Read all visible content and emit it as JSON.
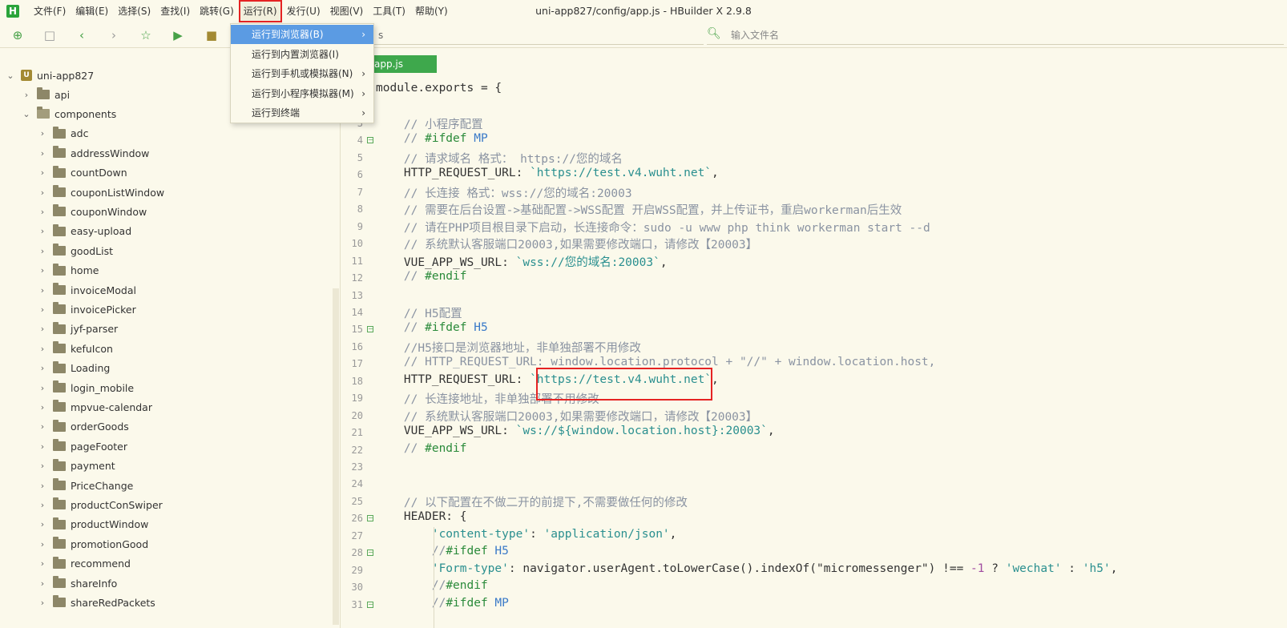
{
  "window": {
    "title": "uni-app827/config/app.js - HBuilder X 2.9.8",
    "logo": "H"
  },
  "menubar": [
    {
      "id": "file",
      "label": "文件(F)"
    },
    {
      "id": "edit",
      "label": "编辑(E)"
    },
    {
      "id": "select",
      "label": "选择(S)"
    },
    {
      "id": "find",
      "label": "查找(I)"
    },
    {
      "id": "goto",
      "label": "跳转(G)"
    },
    {
      "id": "run",
      "label": "运行(R)"
    },
    {
      "id": "publish",
      "label": "发行(U)"
    },
    {
      "id": "view",
      "label": "视图(V)"
    },
    {
      "id": "tools",
      "label": "工具(T)"
    },
    {
      "id": "help",
      "label": "帮助(Y)"
    }
  ],
  "run_menu": [
    {
      "label": "运行到浏览器(B)",
      "submenu": true,
      "highlighted": true
    },
    {
      "label": "运行到内置浏览器(I)",
      "submenu": false
    },
    {
      "label": "运行到手机或模拟器(N)",
      "submenu": true
    },
    {
      "label": "运行到小程序模拟器(M)",
      "submenu": true
    },
    {
      "label": "运行到终端",
      "submenu": true
    }
  ],
  "toolbar": {
    "path_fragment": "s",
    "file_search_placeholder": "输入文件名"
  },
  "sidebar": {
    "project": "uni-app827",
    "items": [
      {
        "label": "api",
        "level": 1,
        "expanded": false
      },
      {
        "label": "components",
        "level": 1,
        "expanded": true
      },
      {
        "label": "adc",
        "level": 2
      },
      {
        "label": "addressWindow",
        "level": 2
      },
      {
        "label": "countDown",
        "level": 2
      },
      {
        "label": "couponListWindow",
        "level": 2
      },
      {
        "label": "couponWindow",
        "level": 2
      },
      {
        "label": "easy-upload",
        "level": 2
      },
      {
        "label": "goodList",
        "level": 2
      },
      {
        "label": "home",
        "level": 2
      },
      {
        "label": "invoiceModal",
        "level": 2
      },
      {
        "label": "invoicePicker",
        "level": 2
      },
      {
        "label": "jyf-parser",
        "level": 2
      },
      {
        "label": "kefuIcon",
        "level": 2
      },
      {
        "label": "Loading",
        "level": 2
      },
      {
        "label": "login_mobile",
        "level": 2
      },
      {
        "label": "mpvue-calendar",
        "level": 2
      },
      {
        "label": "orderGoods",
        "level": 2
      },
      {
        "label": "pageFooter",
        "level": 2
      },
      {
        "label": "payment",
        "level": 2
      },
      {
        "label": "PriceChange",
        "level": 2
      },
      {
        "label": "productConSwiper",
        "level": 2
      },
      {
        "label": "productWindow",
        "level": 2
      },
      {
        "label": "promotionGood",
        "level": 2
      },
      {
        "label": "recommend",
        "level": 2
      },
      {
        "label": "shareInfo",
        "level": 2
      },
      {
        "label": "shareRedPackets",
        "level": 2
      }
    ]
  },
  "editor": {
    "tab_label": "app.js",
    "lines": [
      {
        "n": "",
        "segs": [
          [
            "module.exports = {",
            ""
          ]
        ],
        "fold": ""
      },
      {
        "n": "3",
        "segs": [
          [
            "    // 小程序配置",
            "cm"
          ]
        ],
        "fold": ""
      },
      {
        "n": "4",
        "segs": [
          [
            "    // ",
            "cm"
          ],
          [
            "#ifdef",
            "kw"
          ],
          [
            " MP",
            "mac"
          ]
        ],
        "fold": "minus"
      },
      {
        "n": "5",
        "segs": [
          [
            "    // 请求域名 格式： https://您的域名",
            "cm"
          ]
        ],
        "fold": ""
      },
      {
        "n": "6",
        "segs": [
          [
            "    HTTP_REQUEST_URL: ",
            ""
          ],
          [
            "`https://test.v4.wuht.net`",
            "str"
          ],
          [
            ",",
            ""
          ]
        ],
        "fold": ""
      },
      {
        "n": "7",
        "segs": [
          [
            "    // 长连接 格式：wss://您的域名:20003",
            "cm"
          ]
        ],
        "fold": ""
      },
      {
        "n": "8",
        "segs": [
          [
            "    // 需要在后台设置->基础配置->WSS配置 开启WSS配置，并上传证书，重启workerman后生效",
            "cm"
          ]
        ],
        "fold": ""
      },
      {
        "n": "9",
        "segs": [
          [
            "    // 请在PHP项目根目录下启动，长连接命令：sudo -u www php think workerman start --d",
            "cm"
          ]
        ],
        "fold": ""
      },
      {
        "n": "10",
        "segs": [
          [
            "    // 系统默认客服端口20003,如果需要修改端口，请修改【20003】",
            "cm"
          ]
        ],
        "fold": ""
      },
      {
        "n": "11",
        "segs": [
          [
            "    VUE_APP_WS_URL: ",
            ""
          ],
          [
            "`wss://您的域名:20003`",
            "str"
          ],
          [
            ",",
            ""
          ]
        ],
        "fold": ""
      },
      {
        "n": "12",
        "segs": [
          [
            "    // ",
            "cm"
          ],
          [
            "#endif",
            "kw"
          ]
        ],
        "fold": ""
      },
      {
        "n": "13",
        "segs": [
          [
            "",
            ""
          ]
        ],
        "fold": ""
      },
      {
        "n": "14",
        "segs": [
          [
            "    // H5配置",
            "cm"
          ]
        ],
        "fold": ""
      },
      {
        "n": "15",
        "segs": [
          [
            "    // ",
            "cm"
          ],
          [
            "#ifdef",
            "kw"
          ],
          [
            " H5",
            "mac"
          ]
        ],
        "fold": "minus"
      },
      {
        "n": "16",
        "segs": [
          [
            "    //H5接口是浏览器地址，非单独部署不用修改",
            "cm"
          ]
        ],
        "fold": ""
      },
      {
        "n": "17",
        "segs": [
          [
            "    // HTTP_REQUEST_URL: window.location.protocol + \"//\" + window.location.host,",
            "cm"
          ]
        ],
        "fold": ""
      },
      {
        "n": "18",
        "segs": [
          [
            "    HTTP_REQUEST_URL: ",
            ""
          ],
          [
            "`https://test.v4.wuht.net`",
            "str"
          ],
          [
            ",",
            ""
          ]
        ],
        "fold": ""
      },
      {
        "n": "19",
        "segs": [
          [
            "    // 长连接地址，非单独部署不用修改",
            "cm"
          ]
        ],
        "fold": ""
      },
      {
        "n": "20",
        "segs": [
          [
            "    // 系统默认客服端口20003,如果需要修改端口，请修改【20003】",
            "cm"
          ]
        ],
        "fold": ""
      },
      {
        "n": "21",
        "segs": [
          [
            "    VUE_APP_WS_URL: ",
            ""
          ],
          [
            "`ws://${window.location.host}:20003`",
            "str"
          ],
          [
            ",",
            ""
          ]
        ],
        "fold": ""
      },
      {
        "n": "22",
        "segs": [
          [
            "    // ",
            "cm"
          ],
          [
            "#endif",
            "kw"
          ]
        ],
        "fold": ""
      },
      {
        "n": "23",
        "segs": [
          [
            "",
            ""
          ]
        ],
        "fold": ""
      },
      {
        "n": "24",
        "segs": [
          [
            "",
            ""
          ]
        ],
        "fold": ""
      },
      {
        "n": "25",
        "segs": [
          [
            "    // 以下配置在不做二开的前提下,不需要做任何的修改",
            "cm"
          ]
        ],
        "fold": ""
      },
      {
        "n": "26",
        "segs": [
          [
            "    HEADER: {",
            ""
          ]
        ],
        "fold": "minus"
      },
      {
        "n": "27",
        "segs": [
          [
            "        ",
            ""
          ],
          [
            "'content-type'",
            "str"
          ],
          [
            ": ",
            ""
          ],
          [
            "'application/json'",
            "str"
          ],
          [
            ",",
            ""
          ]
        ],
        "fold": ""
      },
      {
        "n": "28",
        "segs": [
          [
            "        //",
            "cm"
          ],
          [
            "#ifdef",
            "kw"
          ],
          [
            " H5",
            "mac"
          ]
        ],
        "fold": "minus"
      },
      {
        "n": "29",
        "segs": [
          [
            "        ",
            ""
          ],
          [
            "'Form-type'",
            "str"
          ],
          [
            ": navigator.userAgent.toLowerCase().indexOf(\"micromessenger\") !== ",
            ""
          ],
          [
            "-1",
            "num"
          ],
          [
            " ? ",
            ""
          ],
          [
            "'wechat'",
            "str"
          ],
          [
            " : ",
            ""
          ],
          [
            "'h5'",
            "str"
          ],
          [
            ",",
            ""
          ]
        ],
        "fold": ""
      },
      {
        "n": "30",
        "segs": [
          [
            "        //",
            "cm"
          ],
          [
            "#endif",
            "kw"
          ]
        ],
        "fold": ""
      },
      {
        "n": "31",
        "segs": [
          [
            "        //",
            "cm"
          ],
          [
            "#ifdef",
            "kw"
          ],
          [
            " MP",
            "mac"
          ]
        ],
        "fold": "minus"
      }
    ]
  }
}
